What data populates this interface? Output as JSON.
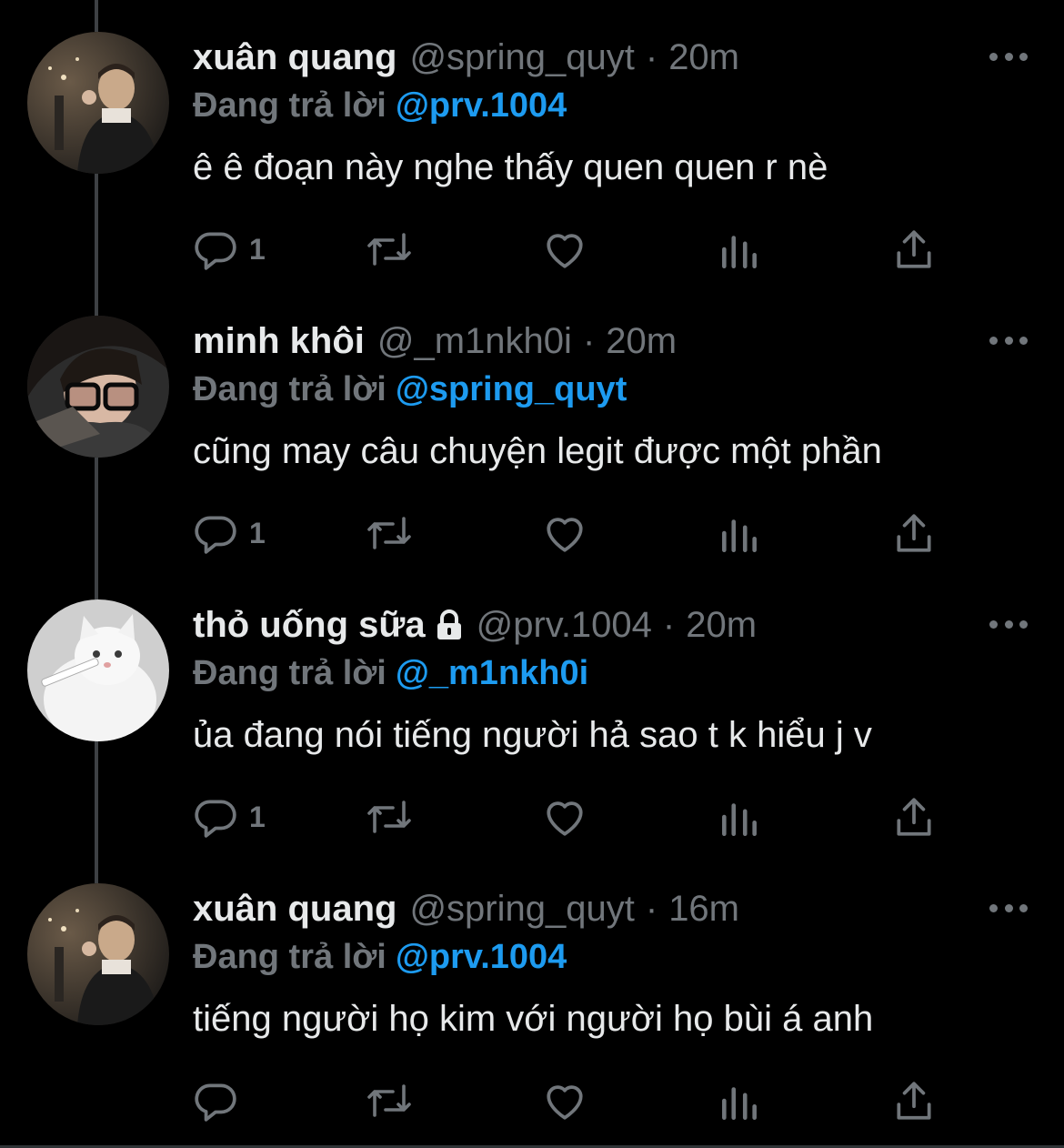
{
  "tweets": [
    {
      "name": "xuân quang",
      "handle": "@spring_quyt",
      "dot": "·",
      "time": "20m",
      "reply_prefix": "Đang trả lời",
      "reply_to": "@prv.1004",
      "text": "ê ê đoạn này nghe thấy quen quen r nè",
      "reply_count": "1",
      "locked": false,
      "avatar": "person-photo"
    },
    {
      "name": "minh khôi",
      "handle": "@_m1nkh0i",
      "dot": "·",
      "time": "20m",
      "reply_prefix": "Đang trả lời",
      "reply_to": "@spring_quyt",
      "text": "cũng may câu chuyện legit được một phần",
      "reply_count": "1",
      "locked": false,
      "avatar": "person-glasses-photo"
    },
    {
      "name": "thỏ uống sữa",
      "handle": "@prv.1004",
      "dot": "·",
      "time": "20m",
      "reply_prefix": "Đang trả lời",
      "reply_to": "@_m1nkh0i",
      "text": "ủa đang nói tiếng người hả sao t k hiểu j v",
      "reply_count": "1",
      "locked": true,
      "avatar": "white-cat-photo"
    },
    {
      "name": "xuân quang",
      "handle": "@spring_quyt",
      "dot": "·",
      "time": "16m",
      "reply_prefix": "Đang trả lời",
      "reply_to": "@prv.1004",
      "text": "tiếng người họ kim với người họ bùi á anh",
      "reply_count": "",
      "locked": false,
      "avatar": "person-photo"
    }
  ],
  "icons": {
    "reply": "reply-icon",
    "retweet": "retweet-icon",
    "like": "heart-icon",
    "views": "analytics-icon",
    "share": "share-icon",
    "more": "more-icon",
    "lock": "lock-icon"
  },
  "colors": {
    "background": "#000000",
    "text": "#e7e9ea",
    "muted": "#71767b",
    "link": "#1d9bf0",
    "thread_line": "#3e4144"
  }
}
